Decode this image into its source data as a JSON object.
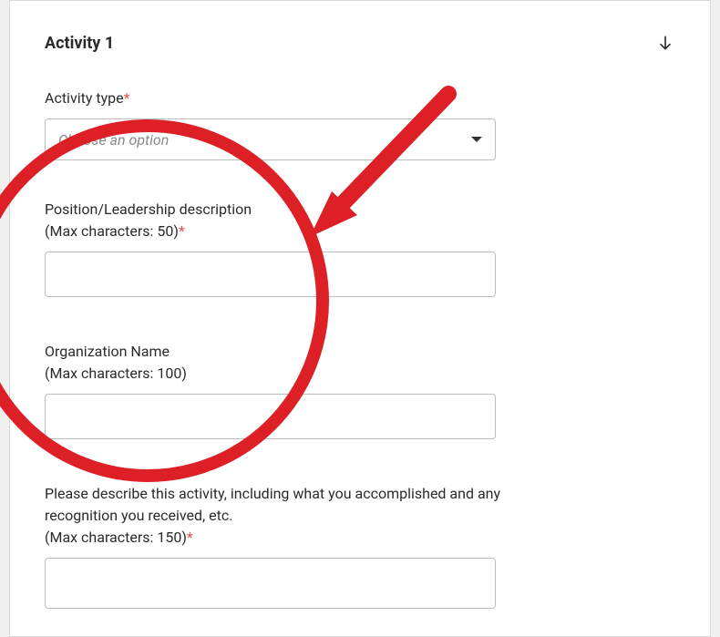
{
  "header": {
    "title": "Activity 1"
  },
  "fields": {
    "activity_type": {
      "label": "Activity type",
      "required": "*",
      "placeholder": "Choose an option"
    },
    "position": {
      "label_line1": "Position/Leadership description",
      "label_line2": "(Max characters: 50)",
      "required": "*"
    },
    "organization": {
      "label_line1": "Organization Name",
      "label_line2": "(Max characters: 100)"
    },
    "description": {
      "label_line1": "Please describe this activity, including what you accomplished and any recognition you received, etc.",
      "label_line2": "(Max characters: 150)",
      "required": "*"
    }
  }
}
